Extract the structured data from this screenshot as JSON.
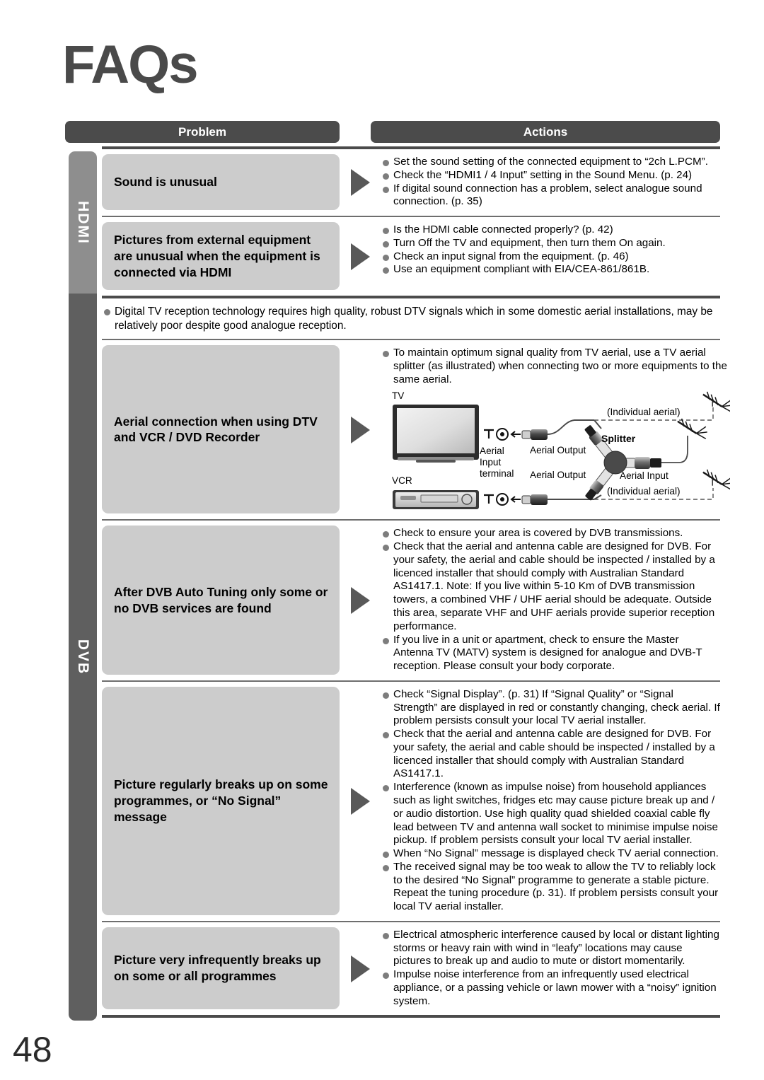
{
  "page": {
    "title": "FAQs",
    "number": "48"
  },
  "header": {
    "problem_label": "Problem",
    "actions_label": "Actions"
  },
  "side_tabs": [
    {
      "id": "hdmi",
      "label": "HDMI",
      "color": "#8e8e8e"
    },
    {
      "id": "dvb",
      "label": "DVB",
      "color": "#5f5f5f"
    }
  ],
  "rows": [
    {
      "problem": "Sound is unusual",
      "actions": [
        {
          "text": "Set the sound setting of the connected equipment to “2ch L.PCM”."
        },
        {
          "text": "Check the “HDMI1 / 4 Input” setting in the Sound Menu. (p. 24)"
        },
        {
          "text": "If digital sound connection has a problem, select analogue sound connection. (p. 35)"
        }
      ]
    },
    {
      "problem": "Pictures from external equipment are unusual when the equipment is connected via HDMI",
      "actions": [
        {
          "text": "Is the HDMI cable connected properly? (p. 42)"
        },
        {
          "text": "Turn Off the TV and equipment, then turn them On again."
        },
        {
          "text": "Check an input signal from the equipment. (p. 46)"
        },
        {
          "text": "Use an equipment compliant with EIA/CEA-861/861B."
        }
      ]
    }
  ],
  "dvb_note": "Digital TV reception technology requires high quality, robust DTV signals which in some domestic aerial installations, may be relatively poor despite good analogue reception.",
  "dvb_rows": [
    {
      "problem": "Aerial connection when using DTV and VCR / DVD Recorder",
      "actions": [
        {
          "text": "To maintain optimum signal quality from TV aerial, use a TV aerial splitter (as illustrated) when connecting two or more equipments to the same aerial."
        }
      ],
      "diagram": {
        "tv_label": "TV",
        "vcr_label": "VCR",
        "aerial_input_terminal": "Aerial\nInput\nterminal",
        "aerial_input_terminal_lines": [
          "Aerial",
          "Input",
          "terminal"
        ],
        "aerial_output_top": "Aerial Output",
        "aerial_output_bottom": "Aerial Output",
        "splitter_label": "Splitter",
        "aerial_input_label": "Aerial Input",
        "individual_aerial_top": "(Individual aerial)",
        "individual_aerial_bottom": "(Individual aerial)"
      }
    },
    {
      "problem": "After DVB Auto Tuning only some or no DVB services are found",
      "actions": [
        {
          "text": "Check to ensure your area is covered by DVB transmissions."
        },
        {
          "text": "Check that the aerial and antenna cable are designed for DVB. For your safety, the aerial and cable should be inspected / installed by a licenced installer that should comply with Australian Standard AS1417.1. Note: If you live within 5-10 Km of DVB transmission towers, a combined VHF / UHF aerial should be adequate. Outside this area, separate VHF and UHF aerials provide superior reception performance."
        },
        {
          "text": "If you live in a unit or apartment, check to ensure the Master Antenna TV (MATV) system is designed for analogue and DVB-T reception. Please consult your body corporate."
        }
      ]
    },
    {
      "problem": "Picture regularly breaks up on some programmes, or “No Signal” message",
      "actions": [
        {
          "text": "Check “Signal Display”. (p. 31) If “Signal Quality” or “Signal Strength” are displayed in red or constantly changing, check aerial. If problem persists consult your local TV aerial installer."
        },
        {
          "text": "Check that the aerial and antenna cable are designed for DVB. For your safety, the aerial and cable should be inspected / installed by a licenced installer that should comply with Australian Standard AS1417.1."
        },
        {
          "text": "Interference (known as impulse noise) from household appliances such as light switches, fridges etc may cause picture break up and / or audio distortion. Use high quality quad shielded coaxial cable fly lead between TV and antenna wall socket to minimise impulse noise pickup. If problem persists consult your local TV aerial installer."
        },
        {
          "text": "When “No Signal” message is displayed check TV aerial connection."
        },
        {
          "text": "The received signal may be too weak to allow the TV to reliably lock to the desired “No Signal” programme to generate a stable picture. Repeat the tuning procedure (p. 31). If problem persists consult your local TV aerial installer."
        }
      ]
    },
    {
      "problem": "Picture very infrequently breaks up on some or all programmes",
      "actions": [
        {
          "text": "Electrical atmospheric interference caused by local or distant lighting storms or heavy rain with wind in “leafy” locations may cause pictures to break up and audio to mute or distort momentarily."
        },
        {
          "text": "Impulse noise interference from an infrequently used electrical appliance, or a passing vehicle or lawn mower with a “noisy” ignition system."
        }
      ]
    }
  ]
}
